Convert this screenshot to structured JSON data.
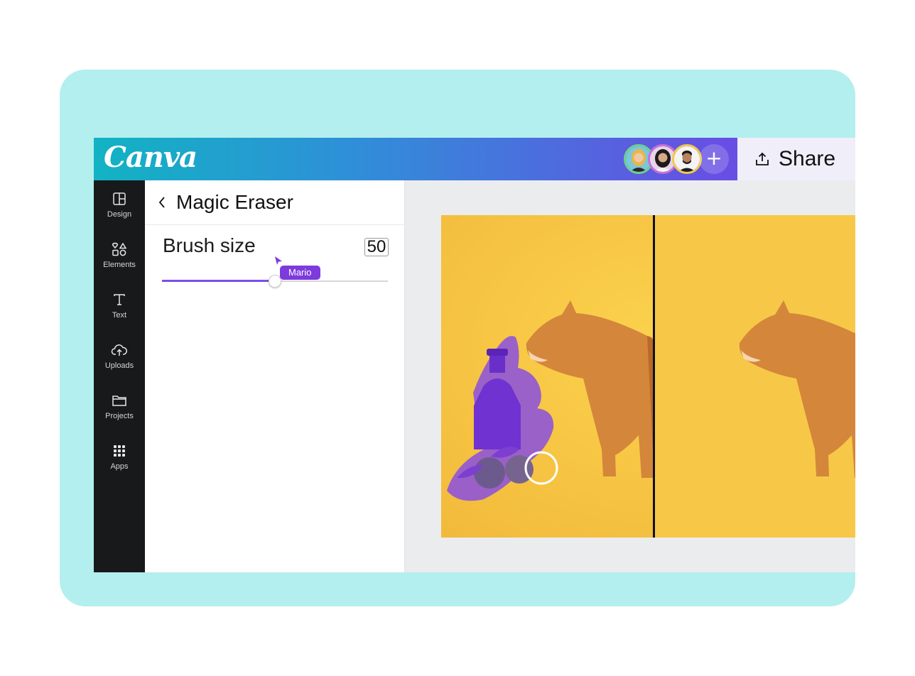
{
  "app": {
    "logo": "Canva",
    "brand_gradient": [
      "#12b3c3",
      "#6a4de4"
    ],
    "backdrop_color": "#b3efee"
  },
  "topbar": {
    "collaborators": [
      {
        "name": "avatar-1",
        "ring": "#f2c94c"
      },
      {
        "name": "avatar-2",
        "ring": "#f2c94c"
      },
      {
        "name": "avatar-3",
        "ring": "#f2c94c"
      }
    ],
    "add_icon": "+",
    "share_label": "Share",
    "share_icon": "upload-icon"
  },
  "sidebar": {
    "items": [
      {
        "label": "Design",
        "icon": "layout-icon"
      },
      {
        "label": "Elements",
        "icon": "shapes-icon"
      },
      {
        "label": "Text",
        "icon": "text-icon"
      },
      {
        "label": "Uploads",
        "icon": "cloud-upload-icon"
      },
      {
        "label": "Projects",
        "icon": "folder-icon"
      },
      {
        "label": "Apps",
        "icon": "apps-grid-icon"
      }
    ]
  },
  "panel": {
    "back_icon": "chevron-left-icon",
    "title": "Magic Eraser",
    "brush_label": "Brush size",
    "brush_value": "50",
    "slider_fraction": 0.5,
    "cursor_user": "Mario",
    "cursor_color": "#7d3bde"
  },
  "canvas": {
    "background": "#f6c642",
    "highlight_color": "#8a4fe0"
  }
}
